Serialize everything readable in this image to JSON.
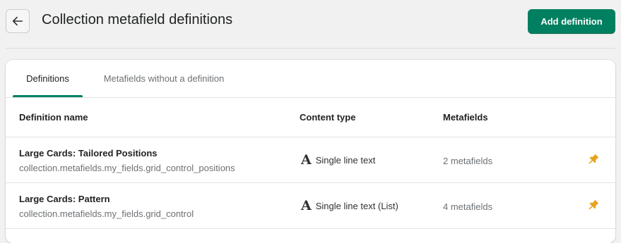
{
  "header": {
    "back_label": "Back",
    "title": "Collection metafield definitions",
    "add_button_label": "Add definition"
  },
  "tabs": [
    {
      "label": "Definitions",
      "selected": true
    },
    {
      "label": "Metafields without a definition",
      "selected": false
    }
  ],
  "table": {
    "columns": [
      "Definition name",
      "Content type",
      "Metafields"
    ],
    "rows": [
      {
        "name": "Large Cards: Tailored Positions",
        "key": "collection.metafields.my_fields.grid_control_positions",
        "content_type": "Single line text",
        "content_type_icon": "letter-a-icon",
        "metafields": "2 metafields",
        "pinned": true
      },
      {
        "name": "Large Cards: Pattern",
        "key": "collection.metafields.my_fields.grid_control",
        "content_type": "Single line text (List)",
        "content_type_icon": "letter-a-icon",
        "metafields": "4 metafields",
        "pinned": true
      }
    ]
  },
  "colors": {
    "accent": "#008060",
    "pin": "#e8a21e",
    "background": "#f1f1f1"
  }
}
